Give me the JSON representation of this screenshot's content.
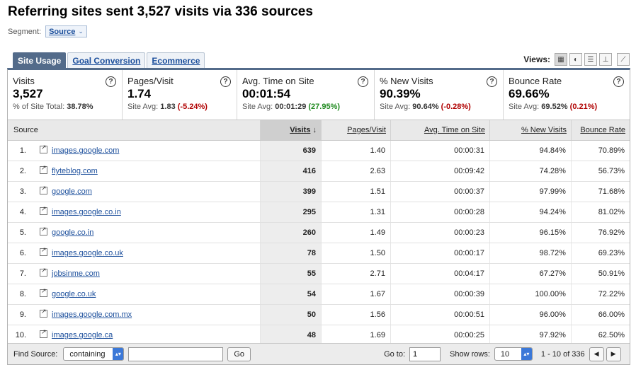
{
  "title": "Referring sites sent 3,527 visits via 336 sources",
  "segment": {
    "label": "Segment:",
    "value": "Source",
    "icon": "chevron-down-icon"
  },
  "tabs": [
    {
      "label": "Site Usage",
      "active": true
    },
    {
      "label": "Goal Conversion",
      "active": false
    },
    {
      "label": "Ecommerce",
      "active": false
    }
  ],
  "views": {
    "label": "Views:",
    "buttons": [
      "table-view-icon",
      "pie-view-icon",
      "bar-view-icon",
      "comparison-view-icon",
      "pivot-view-icon"
    ]
  },
  "summary": [
    {
      "label": "Visits",
      "value": "3,527",
      "sub_prefix": "% of Site Total:",
      "sub_value": "38.78%",
      "delta": "",
      "delta_type": ""
    },
    {
      "label": "Pages/Visit",
      "value": "1.74",
      "sub_prefix": "Site Avg:",
      "sub_value": "1.83",
      "delta": "(-5.24%)",
      "delta_type": "neg"
    },
    {
      "label": "Avg. Time on Site",
      "value": "00:01:54",
      "sub_prefix": "Site Avg:",
      "sub_value": "00:01:29",
      "delta": "(27.95%)",
      "delta_type": "pos"
    },
    {
      "label": "% New Visits",
      "value": "90.39%",
      "sub_prefix": "Site Avg:",
      "sub_value": "90.64%",
      "delta": "(-0.28%)",
      "delta_type": "neg"
    },
    {
      "label": "Bounce Rate",
      "value": "69.66%",
      "sub_prefix": "Site Avg:",
      "sub_value": "69.52%",
      "delta": "(0.21%)",
      "delta_type": "neg"
    }
  ],
  "table": {
    "columns": [
      "Source",
      "Visits",
      "Pages/Visit",
      "Avg. Time on Site",
      "% New Visits",
      "Bounce Rate"
    ],
    "sort_arrow": "↓",
    "rows": [
      {
        "idx": "1.",
        "source": "images.google.com",
        "visits": "639",
        "ppv": "1.40",
        "time": "00:00:31",
        "newv": "94.84%",
        "bounce": "70.89%"
      },
      {
        "idx": "2.",
        "source": "flyteblog.com",
        "visits": "416",
        "ppv": "2.63",
        "time": "00:09:42",
        "newv": "74.28%",
        "bounce": "56.73%"
      },
      {
        "idx": "3.",
        "source": "google.com",
        "visits": "399",
        "ppv": "1.51",
        "time": "00:00:37",
        "newv": "97.99%",
        "bounce": "71.68%"
      },
      {
        "idx": "4.",
        "source": "images.google.co.in",
        "visits": "295",
        "ppv": "1.31",
        "time": "00:00:28",
        "newv": "94.24%",
        "bounce": "81.02%"
      },
      {
        "idx": "5.",
        "source": "google.co.in",
        "visits": "260",
        "ppv": "1.49",
        "time": "00:00:23",
        "newv": "96.15%",
        "bounce": "76.92%"
      },
      {
        "idx": "6.",
        "source": "images.google.co.uk",
        "visits": "78",
        "ppv": "1.50",
        "time": "00:00:17",
        "newv": "98.72%",
        "bounce": "69.23%"
      },
      {
        "idx": "7.",
        "source": "jobsinme.com",
        "visits": "55",
        "ppv": "2.71",
        "time": "00:04:17",
        "newv": "67.27%",
        "bounce": "50.91%"
      },
      {
        "idx": "8.",
        "source": "google.co.uk",
        "visits": "54",
        "ppv": "1.67",
        "time": "00:00:39",
        "newv": "100.00%",
        "bounce": "72.22%"
      },
      {
        "idx": "9.",
        "source": "images.google.com.mx",
        "visits": "50",
        "ppv": "1.56",
        "time": "00:00:51",
        "newv": "96.00%",
        "bounce": "66.00%"
      },
      {
        "idx": "10.",
        "source": "images.google.ca",
        "visits": "48",
        "ppv": "1.69",
        "time": "00:00:25",
        "newv": "97.92%",
        "bounce": "62.50%"
      }
    ]
  },
  "footer": {
    "find_label": "Find Source:",
    "match_value": "containing",
    "find_value": "",
    "go_label": "Go",
    "goto_label": "Go to:",
    "goto_value": "1",
    "showrows_label": "Show rows:",
    "showrows_value": "10",
    "range": "1 - 10 of 336",
    "prev": "◀",
    "next": "▶"
  }
}
